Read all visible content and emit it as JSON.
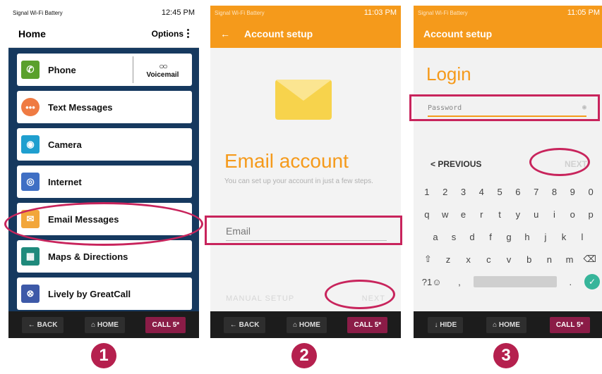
{
  "phone1": {
    "status": {
      "left": "Signal  Wi-Fi  Battery",
      "time": "12:45 PM"
    },
    "header": {
      "title": "Home",
      "options": "Options"
    },
    "menu": [
      {
        "label": "Phone",
        "icon": "phone-icon",
        "color": "#5aa02c"
      },
      {
        "label": "Text Messages",
        "icon": "chat-bubble-icon",
        "color": "#ef7b43"
      },
      {
        "label": "Camera",
        "icon": "camera-icon",
        "color": "#1f9fcf"
      },
      {
        "label": "Internet",
        "icon": "globe-icon",
        "color": "#3f6fc4"
      },
      {
        "label": "Email Messages",
        "icon": "envelope-icon",
        "color": "#f2a63a"
      },
      {
        "label": "Maps & Directions",
        "icon": "map-icon",
        "color": "#1f8a7c"
      },
      {
        "label": "Lively by GreatCall",
        "icon": "lively-icon",
        "color": "#3d59a8"
      }
    ],
    "voicemail": "Voicemail",
    "nav": {
      "back": "BACK",
      "home": "HOME",
      "call": "CALL 5*"
    }
  },
  "phone2": {
    "status": {
      "left": "Signal  Wi-Fi  Battery",
      "time": "11:03 PM"
    },
    "appbar": {
      "title": "Account setup"
    },
    "title": "Email account",
    "subtitle": "You can set up your account in just a few steps.",
    "email_placeholder": "Email",
    "manual_setup": "MANUAL SETUP",
    "next": "NEXT",
    "nav": {
      "back": "BACK",
      "home": "HOME",
      "call": "CALL 5*"
    }
  },
  "phone3": {
    "status": {
      "left": "Signal  Wi-Fi  Battery",
      "time": "11:05 PM"
    },
    "appbar": {
      "title": "Account setup"
    },
    "title": "Login",
    "password_placeholder": "Password",
    "previous": "< PREVIOUS",
    "next": "NEXT",
    "keyboard": {
      "row1": [
        "1",
        "2",
        "3",
        "4",
        "5",
        "6",
        "7",
        "8",
        "9",
        "0"
      ],
      "row2": [
        "q",
        "w",
        "e",
        "r",
        "t",
        "y",
        "u",
        "i",
        "o",
        "p"
      ],
      "row3": [
        "a",
        "s",
        "d",
        "f",
        "g",
        "h",
        "j",
        "k",
        "l"
      ],
      "row4": [
        "⇧",
        "z",
        "x",
        "c",
        "v",
        "b",
        "n",
        "m",
        "⌫"
      ],
      "symbols": "?1☺",
      "comma": ",",
      "period": "."
    },
    "nav": {
      "hide": "HIDE",
      "home": "HOME",
      "call": "CALL 5*"
    }
  },
  "steps": [
    "1",
    "2",
    "3"
  ],
  "colors": {
    "accent_orange": "#f59a1b",
    "highlight_ring": "#c8245c",
    "menu_bg": "#16395f"
  }
}
